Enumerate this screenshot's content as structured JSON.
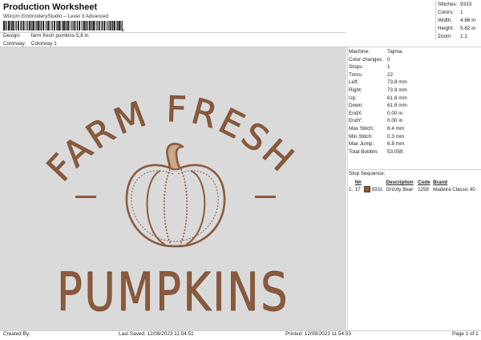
{
  "header": {
    "title": "Production Worksheet",
    "subtitle": "Wilcom EmbroideryStudio – Level 3 Advanced",
    "barcode_suffix": ","
  },
  "meta": {
    "design_label": "Design:",
    "design_value": "farm fresh pumkins 5,8 in",
    "colorway_label": "Colorway:",
    "colorway_value": "Colorway 1"
  },
  "stats": [
    {
      "label": "Stitches:",
      "value": "9333"
    },
    {
      "label": "Colors:",
      "value": "1"
    },
    {
      "label": "Width:",
      "value": "4.86 in"
    },
    {
      "label": "Height:",
      "value": "5.82 in"
    },
    {
      "label": "Zoom:",
      "value": "1:1"
    }
  ],
  "machine": [
    {
      "label": "Machine:",
      "value": "Tajima"
    },
    {
      "label": "Color changes:",
      "value": "0"
    },
    {
      "label": "Stops:",
      "value": "1"
    },
    {
      "label": "Trims:",
      "value": "22"
    },
    {
      "label": "Left:",
      "value": "73.8 mm"
    },
    {
      "label": "Right:",
      "value": "73.9 mm"
    },
    {
      "label": "Up:",
      "value": "61.8 mm"
    },
    {
      "label": "Down:",
      "value": "61.8 mm"
    },
    {
      "label": "EndX:",
      "value": "0.00 in"
    },
    {
      "label": "EndY:",
      "value": "0.00 in"
    },
    {
      "label": "Max Stitch:",
      "value": "6.4 mm"
    },
    {
      "label": "Min Stitch:",
      "value": "0.3 mm"
    },
    {
      "label": "Max Jump:",
      "value": "6.8 mm"
    },
    {
      "label": "Total Bobbin:",
      "value": "53.05ft"
    }
  ],
  "stop_sequence": {
    "title": "Stop Sequence:",
    "headers": [
      "",
      "N#",
      "",
      "Description",
      "Code",
      "Brand"
    ],
    "rows": [
      {
        "index": "1.",
        "n": "17",
        "code_num": "9331",
        "description": "Grizzly Bear",
        "code": "1258",
        "brand": "Madeira Classic 40",
        "color": "#8b5a3c"
      }
    ]
  },
  "design": {
    "line1": "FARM FRESH",
    "line2": "PUMPKINS",
    "thread_color": "#8b5a3c",
    "background": "#dadada"
  },
  "footer": {
    "created_by": "Created By:",
    "last_saved": "Last Saved: 12/08/2023 11.54.51",
    "printed": "Printed: 12/08/2023 11.54.53",
    "page": "Page 1 of 1"
  }
}
